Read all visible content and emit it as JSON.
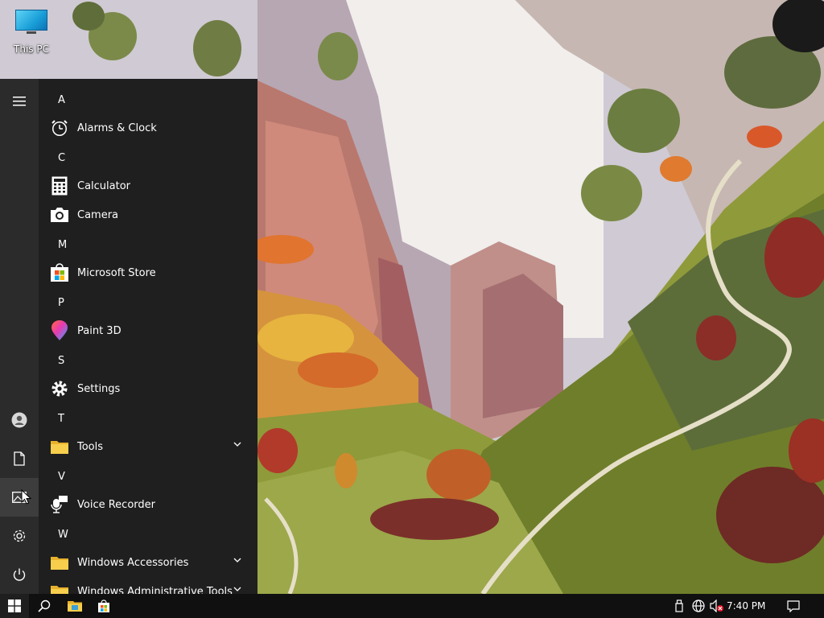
{
  "desktop": {
    "icons": [
      {
        "label": "This PC",
        "icon": "this-pc-icon"
      }
    ]
  },
  "start_menu": {
    "rail": [
      {
        "name": "hamburger-menu-icon"
      },
      {
        "name": "user-account-icon"
      },
      {
        "name": "documents-icon"
      },
      {
        "name": "pictures-icon",
        "active": true
      },
      {
        "name": "settings-gear-icon"
      },
      {
        "name": "power-icon"
      }
    ],
    "groups": [
      {
        "letter": "A",
        "apps": [
          {
            "label": "Alarms & Clock",
            "icon": "alarm-clock-icon"
          }
        ]
      },
      {
        "letter": "C",
        "apps": [
          {
            "label": "Calculator",
            "icon": "calculator-icon"
          },
          {
            "label": "Camera",
            "icon": "camera-icon"
          }
        ]
      },
      {
        "letter": "M",
        "apps": [
          {
            "label": "Microsoft Store",
            "icon": "store-icon"
          }
        ]
      },
      {
        "letter": "P",
        "apps": [
          {
            "label": "Paint 3D",
            "icon": "paint3d-icon"
          }
        ]
      },
      {
        "letter": "S",
        "apps": [
          {
            "label": "Settings",
            "icon": "settings-icon"
          }
        ]
      },
      {
        "letter": "T",
        "apps": [
          {
            "label": "Tools",
            "icon": "folder-icon",
            "expandable": true
          }
        ]
      },
      {
        "letter": "V",
        "apps": [
          {
            "label": "Voice Recorder",
            "icon": "microphone-icon"
          }
        ]
      },
      {
        "letter": "W",
        "apps": [
          {
            "label": "Windows Accessories",
            "icon": "folder-icon",
            "expandable": true
          },
          {
            "label": "Windows Administrative Tools",
            "icon": "folder-icon",
            "expandable": true
          }
        ]
      }
    ]
  },
  "taskbar": {
    "pinned": [
      "windows-start-icon",
      "search-icon",
      "file-explorer-icon",
      "store-bag-icon"
    ],
    "tray": [
      "usb-device-icon",
      "network-globe-icon",
      "volume-muted-icon"
    ],
    "time": "7:40 PM",
    "notification_icon": "action-center-icon"
  },
  "colors": {
    "menu_bg": "#1f1f1f",
    "rail_bg": "#2b2b2b",
    "taskbar_bg": "#101010",
    "accent_blue": "#1a9fd8"
  }
}
